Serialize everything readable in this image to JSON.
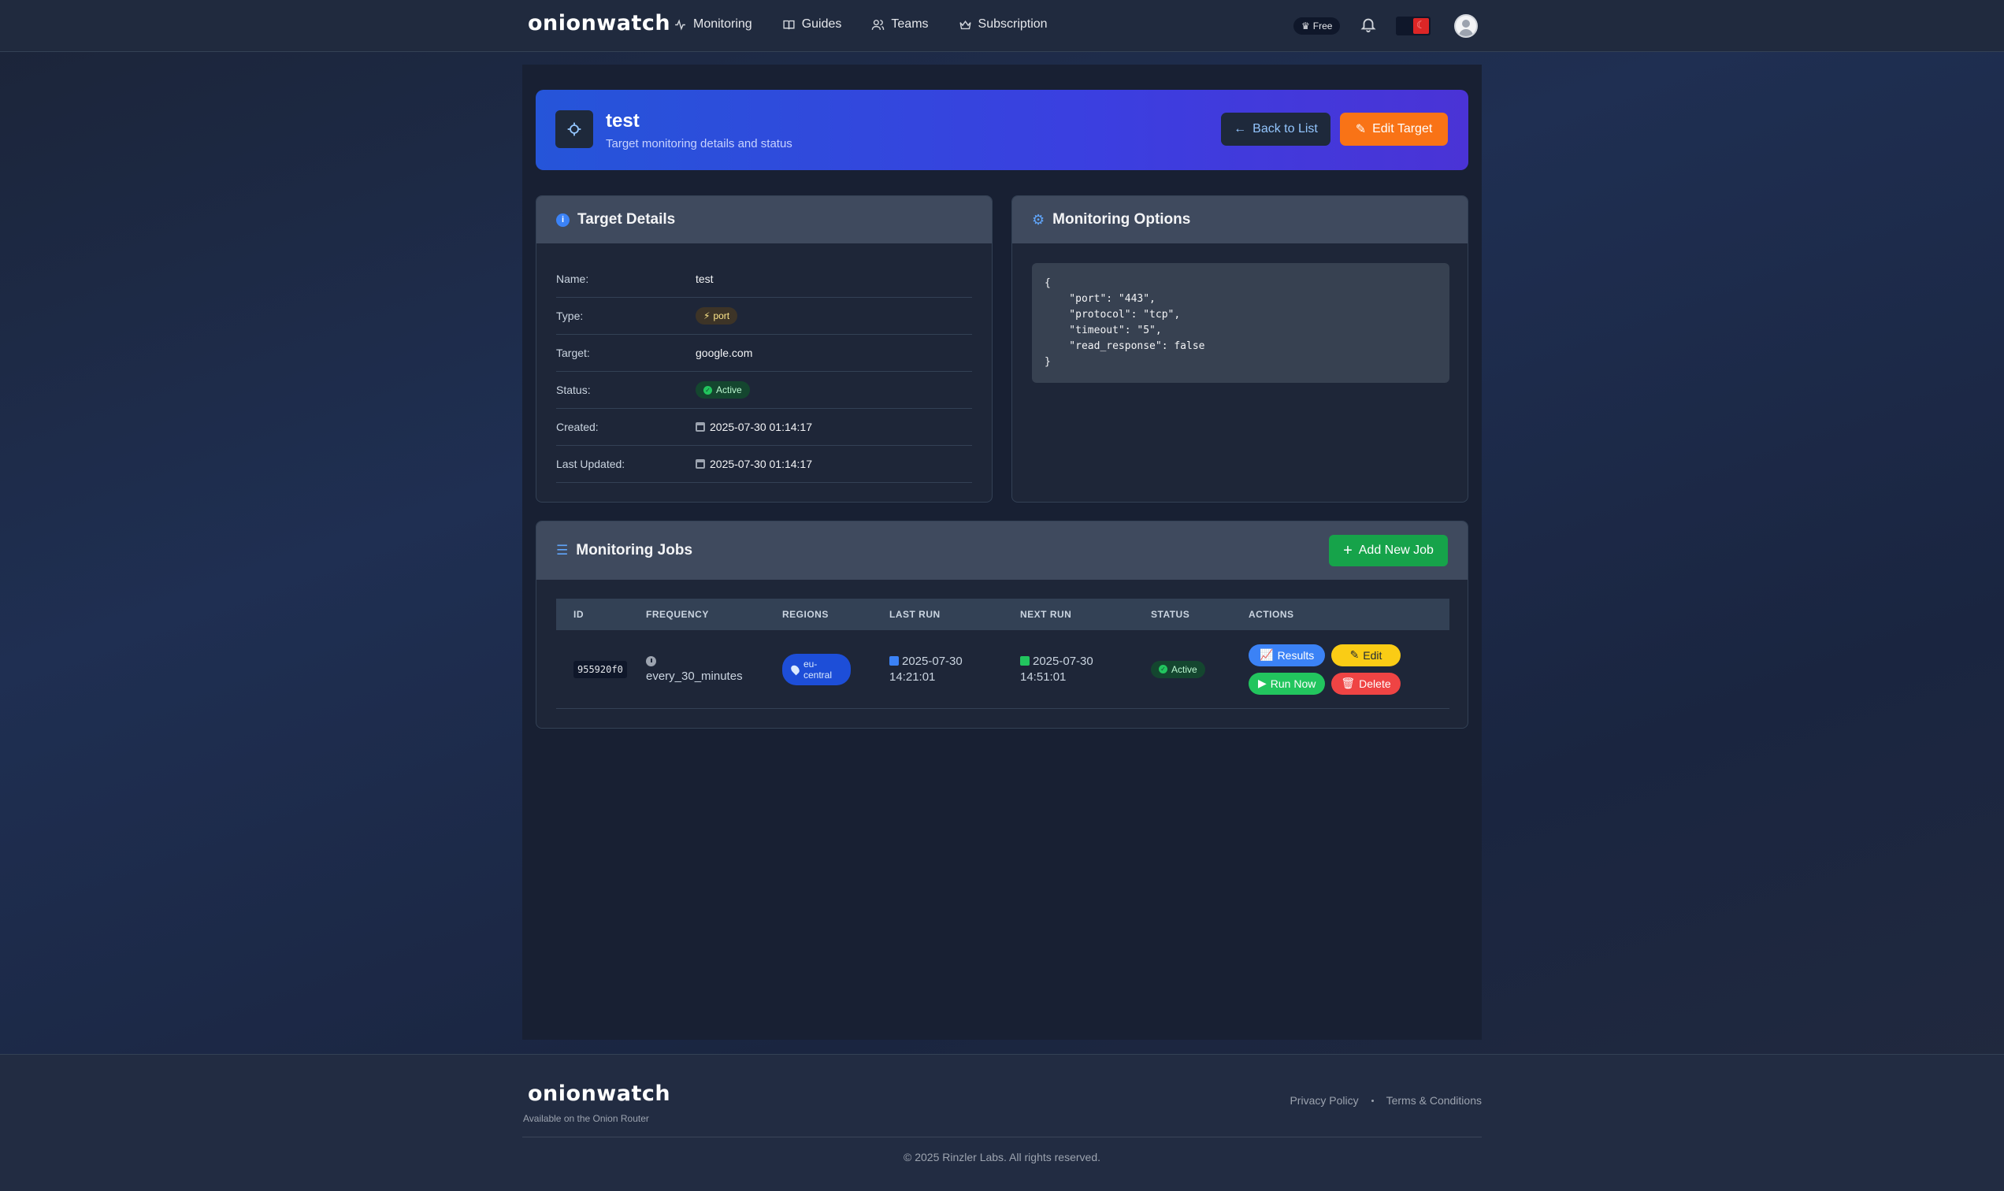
{
  "header": {
    "logo": "onionwatch",
    "nav": [
      {
        "label": "Monitoring",
        "icon": "activity-icon"
      },
      {
        "label": "Guides",
        "icon": "book-icon"
      },
      {
        "label": "Teams",
        "icon": "users-icon"
      },
      {
        "label": "Subscription",
        "icon": "crown-icon"
      }
    ],
    "plan_badge": "Free"
  },
  "hero": {
    "title": "test",
    "subtitle": "Target monitoring details and status",
    "back_label": "Back to List",
    "edit_label": "Edit Target"
  },
  "target_details": {
    "heading": "Target Details",
    "rows": [
      {
        "label": "Name:",
        "value": "test"
      },
      {
        "label": "Type:",
        "value": "port"
      },
      {
        "label": "Target:",
        "value": "google.com"
      },
      {
        "label": "Status:",
        "value": "Active"
      },
      {
        "label": "Created:",
        "value": "2025-07-30 01:14:17"
      },
      {
        "label": "Last Updated:",
        "value": "2025-07-30 01:14:17"
      }
    ]
  },
  "monitoring_options": {
    "heading": "Monitoring Options",
    "json_text": "{\n    \"port\": \"443\",\n    \"protocol\": \"tcp\",\n    \"timeout\": \"5\",\n    \"read_response\": false\n}"
  },
  "jobs": {
    "heading": "Monitoring Jobs",
    "add_label": "Add New Job",
    "columns": [
      "ID",
      "FREQUENCY",
      "REGIONS",
      "LAST RUN",
      "NEXT RUN",
      "STATUS",
      "ACTIONS"
    ],
    "rows": [
      {
        "id": "955920f0",
        "frequency": "every_30_minutes",
        "region_line1": "eu-",
        "region_line2": "central",
        "last_run_date": "2025-07-30",
        "last_run_time": "14:21:01",
        "next_run_date": "2025-07-30",
        "next_run_time": "14:51:01",
        "status": "Active",
        "actions": {
          "results": "Results",
          "edit": "Edit",
          "run": "Run Now",
          "delete": "Delete"
        }
      }
    ]
  },
  "footer": {
    "logo": "onionwatch",
    "tagline": "Available on the Onion Router",
    "privacy": "Privacy Policy",
    "terms": "Terms & Conditions",
    "copyright": "© 2025 Rinzler Labs. All rights reserved."
  }
}
